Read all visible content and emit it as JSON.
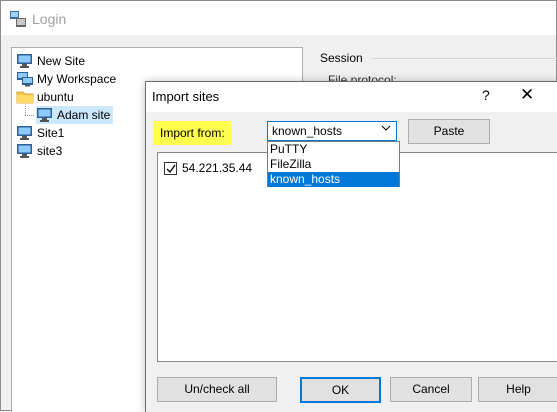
{
  "login_window": {
    "title": "Login",
    "session_label": "Session",
    "file_protocol_label": "File protocol:"
  },
  "site_tree": {
    "items": [
      {
        "label": "New Site",
        "icon": "monitor-icon"
      },
      {
        "label": "My Workspace",
        "icon": "workspace-icon"
      },
      {
        "label": "ubuntu",
        "icon": "folder-icon"
      },
      {
        "label": "Adam site",
        "icon": "monitor-icon",
        "selected": true
      },
      {
        "label": "Site1",
        "icon": "monitor-icon"
      },
      {
        "label": "site3",
        "icon": "monitor-icon"
      }
    ]
  },
  "import_dialog": {
    "title": "Import sites",
    "help_glyph": "?",
    "close_glyph": "✕",
    "import_from_label": "Import from:",
    "import_from_value": "known_hosts",
    "paste_button": "Paste",
    "dropdown_options": [
      "PuTTY",
      "FileZilla",
      "known_hosts"
    ],
    "dropdown_highlighted": "known_hosts",
    "sites": [
      {
        "host": "54.221.35.44",
        "checked": true
      }
    ],
    "uncheck_all_button": "Un/check all",
    "ok_button": "OK",
    "cancel_button": "Cancel",
    "help_button": "Help"
  },
  "colors": {
    "highlight_yellow": "#ffff4d",
    "selection_blue": "#0078d7",
    "tree_selected_bg": "#cce8ff"
  }
}
